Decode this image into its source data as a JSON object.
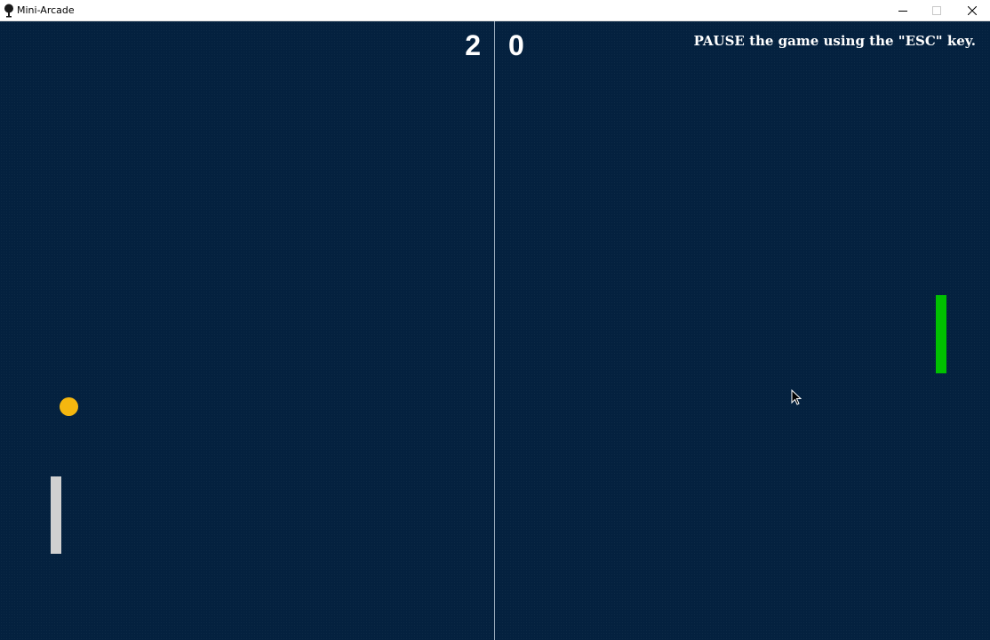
{
  "window": {
    "title": "Mini-Arcade",
    "icons": {
      "app": "tree-icon",
      "minimize": "minimize-icon",
      "maximize": "maximize-icon",
      "close": "close-icon"
    }
  },
  "game": {
    "score_left": "2",
    "score_right": "0",
    "hint": "PAUSE the game using the \"ESC\" key.",
    "colors": {
      "background": "#04213f",
      "center_line": "#9fb0c0",
      "left_paddle": "#d0d0d0",
      "right_paddle": "#00c000",
      "ball": "#f5b70f",
      "text": "#ffffff"
    }
  }
}
